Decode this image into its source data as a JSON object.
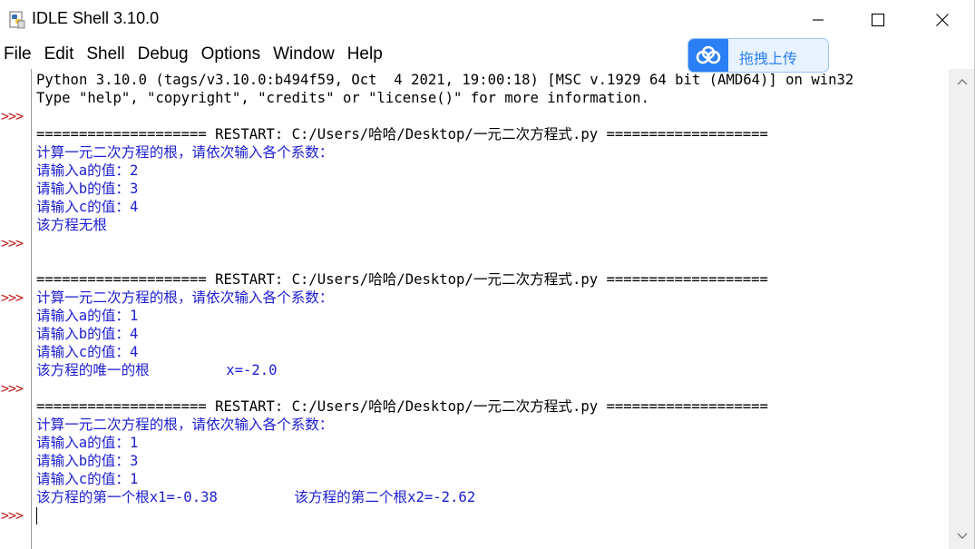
{
  "window": {
    "title": "IDLE Shell 3.10.0",
    "minimize_glyph": "—",
    "maximize_glyph": "☐",
    "close_glyph": "✕"
  },
  "menu": [
    "File",
    "Edit",
    "Shell",
    "Debug",
    "Options",
    "Window",
    "Help"
  ],
  "upload_widget": {
    "label": "拖拽上传",
    "icon": "cloud-icon",
    "accent": "#2b7ff5"
  },
  "shell": {
    "prompt": ">>>",
    "colors": {
      "stdout": "#000000",
      "user_output": "#1d1dd1",
      "prompt": "#c41a1a"
    },
    "lines": [
      {
        "text": "Python 3.10.0 (tags/v3.10.0:b494f59, Oct  4 2021, 19:00:18) [MSC v.1929 64 bit (AMD64)] on win32",
        "style": "out-black",
        "prompt": false
      },
      {
        "text": "Type \"help\", \"copyright\", \"credits\" or \"license()\" for more information.",
        "style": "out-black",
        "prompt": false
      },
      {
        "text": "",
        "style": "out-black",
        "prompt": true
      },
      {
        "text": "==================== RESTART: C:/Users/哈哈/Desktop/一元二次方程式.py ===================",
        "style": "out-black",
        "prompt": false
      },
      {
        "text": "计算一元二次方程的根，请依次输入各个系数：",
        "style": "out-blue",
        "prompt": false
      },
      {
        "text": "请输入a的值：2",
        "style": "out-blue",
        "prompt": false
      },
      {
        "text": "请输入b的值：3",
        "style": "out-blue",
        "prompt": false
      },
      {
        "text": "请输入c的值：4",
        "style": "out-blue",
        "prompt": false
      },
      {
        "text": "该方程无根",
        "style": "out-blue",
        "prompt": false
      },
      {
        "text": "",
        "style": "out-black",
        "prompt": true
      },
      {
        "text": "",
        "style": "out-black",
        "prompt": false
      },
      {
        "text": "==================== RESTART: C:/Users/哈哈/Desktop/一元二次方程式.py ===================",
        "style": "out-black",
        "prompt": false
      },
      {
        "text": "计算一元二次方程的根，请依次输入各个系数：",
        "style": "out-blue",
        "prompt": true
      },
      {
        "text": "请输入a的值：1",
        "style": "out-blue",
        "prompt": false
      },
      {
        "text": "请输入b的值：4",
        "style": "out-blue",
        "prompt": false
      },
      {
        "text": "请输入c的值：4",
        "style": "out-blue",
        "prompt": false
      },
      {
        "text": "该方程的唯一的根         x=-2.0",
        "style": "out-blue",
        "prompt": false
      },
      {
        "text": "",
        "style": "out-black",
        "prompt": true
      },
      {
        "text": "==================== RESTART: C:/Users/哈哈/Desktop/一元二次方程式.py ===================",
        "style": "out-black",
        "prompt": false
      },
      {
        "text": "计算一元二次方程的根，请依次输入各个系数：",
        "style": "out-blue",
        "prompt": false
      },
      {
        "text": "请输入a的值：1",
        "style": "out-blue",
        "prompt": false
      },
      {
        "text": "请输入b的值：3",
        "style": "out-blue",
        "prompt": false
      },
      {
        "text": "请输入c的值：1",
        "style": "out-blue",
        "prompt": false
      },
      {
        "text": "该方程的第一个根x1=-0.38         该方程的第二个根x2=-2.62",
        "style": "out-blue",
        "prompt": false
      },
      {
        "text": "",
        "style": "out-black",
        "prompt": true
      }
    ]
  }
}
